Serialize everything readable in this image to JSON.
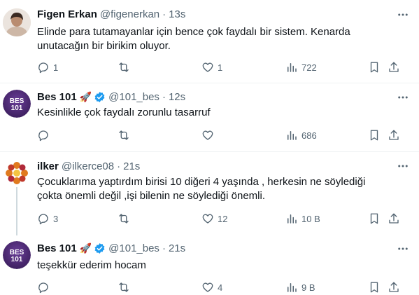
{
  "tweets": [
    {
      "name": "Figen Erkan",
      "handle": "@figenerkan",
      "time": "13s",
      "text": "Elinde para tutamayanlar için bence çok faydalı bir sistem. Kenarda unutacağın bir birikim oluyor.",
      "replies": "1",
      "retweets": "",
      "likes": "1",
      "views": "722"
    },
    {
      "name": "Bes 101",
      "handle": "@101_bes",
      "time": "12s",
      "text": "Kesinlikle çok faydalı zorunlu tasarruf",
      "replies": "",
      "retweets": "",
      "likes": "",
      "views": "686"
    },
    {
      "name": "ilker",
      "handle": "@ilkerce08",
      "time": "21s",
      "text": "Çocuklarıma yaptırdım birisi 10 diğeri 4 yaşında , herkesin ne söylediği çokta önemli değil ,işi bilenin ne söylediği önemli.",
      "replies": "3",
      "retweets": "",
      "likes": "12",
      "views": "10 B"
    },
    {
      "name": "Bes 101",
      "handle": "@101_bes",
      "time": "21s",
      "text": "teşekkür ederim hocam",
      "replies": "",
      "retweets": "",
      "likes": "4",
      "views": "9 B"
    }
  ],
  "avatar_labels": {
    "bes_top": "BES",
    "bes_bottom": "101"
  },
  "rocket_emoji": "🚀",
  "dot": "·",
  "colors": {
    "muted": "#536471",
    "verified": "#1d9bf0",
    "bes_avatar": "#4a2a6e",
    "divider": "#eff3f4"
  },
  "icons": [
    "reply-icon",
    "retweet-icon",
    "like-icon",
    "views-icon",
    "bookmark-icon",
    "share-icon",
    "more-icon",
    "verified-badge-icon"
  ]
}
